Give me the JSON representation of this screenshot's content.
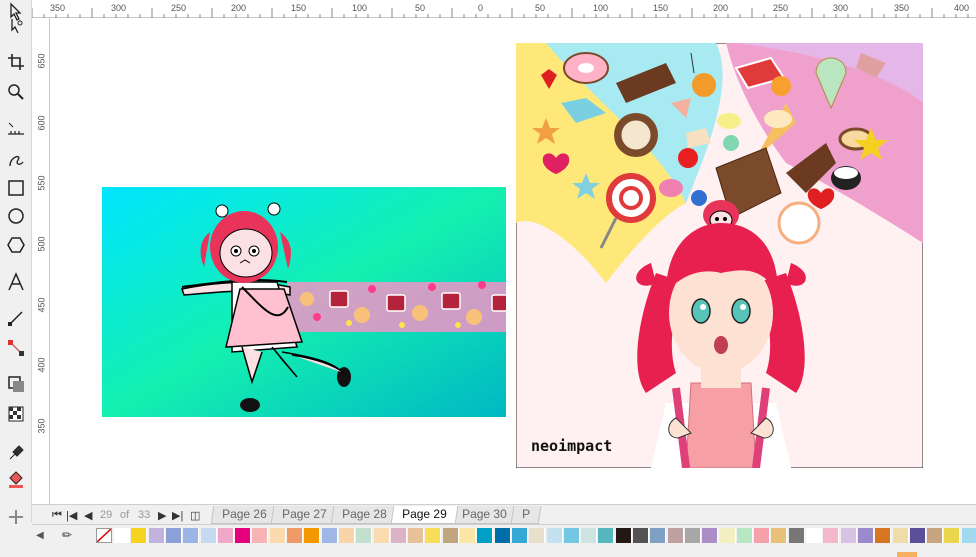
{
  "ruler": {
    "top": [
      "350",
      "300",
      "250",
      "200",
      "150",
      "100",
      "50",
      "0",
      "50",
      "100",
      "150",
      "200",
      "250",
      "300",
      "350",
      "400"
    ],
    "left": [
      "650",
      "600",
      "550",
      "500",
      "450",
      "400",
      "350"
    ]
  },
  "artwork": {
    "signature": "neoimpact",
    "small_chibi_text": "los"
  },
  "page_nav": {
    "current": "29",
    "of_label": "of",
    "total": "33"
  },
  "pages": [
    "Page 26",
    "Page 27",
    "Page 28",
    "Page 29",
    "Page 30",
    "P"
  ],
  "active_page": "Page 29",
  "palette": [
    "#ffffff",
    "#f6d320",
    "#c2b3de",
    "#8aa0d6",
    "#9bb5e6",
    "#c5d9f1",
    "#f0a8c8",
    "#e5007e",
    "#f7b4b4",
    "#fcdab0",
    "#ee9b6a",
    "#f39800",
    "#a0b6e5",
    "#f8d4a8",
    "#c2e0cd",
    "#fadcb0",
    "#dcb2c8",
    "#e8c19a",
    "#f7dd58",
    "#c0a57e",
    "#fde5a6",
    "#00a0c6",
    "#006ea6",
    "#34a9d6",
    "#e8e0cc",
    "#c4e1ef",
    "#73c7e3",
    "#cfe3e3",
    "#56b6bd",
    "#231815",
    "#535353",
    "#7f9fc3",
    "#bea0a0",
    "#a7a7a7",
    "#aa8ec5",
    "#f3efc2",
    "#b7e6c4",
    "#f6a0a9",
    "#e8c078",
    "#777777",
    "#ffffff",
    "#f5b8cb",
    "#d8c3e4",
    "#9a8acb",
    "#d77620",
    "#f0dca9",
    "#5b4f9a",
    "#c6a580",
    "#e9d64e",
    "#a1d9ee",
    "#000000",
    "#e2c9b4"
  ]
}
